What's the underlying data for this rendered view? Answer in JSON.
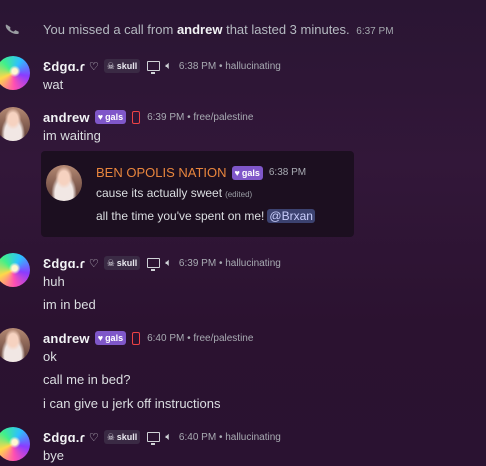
{
  "system": {
    "prefix": "You missed a call from",
    "caller": "andrew",
    "suffix": "that lasted 3 minutes.",
    "time": "6:37 PM"
  },
  "users": {
    "edgar": {
      "name": "Ɛdgɑ.ɾ",
      "heart": "♡",
      "tag": "skull"
    },
    "andrew": {
      "name": "andrew",
      "tag": "gals"
    }
  },
  "messages": [
    {
      "meta": "6:38 PM • hallucinating",
      "lines": [
        "wat"
      ]
    },
    {
      "meta": "6:39 PM • free/palestine",
      "lines": [
        "im waiting"
      ]
    },
    {
      "meta": "6:39 PM • hallucinating",
      "lines": [
        "huh",
        "im in bed"
      ]
    },
    {
      "meta": "6:40 PM • free/palestine",
      "lines": [
        "ok",
        "call me in bed?",
        "i can give u jerk off instructions"
      ]
    },
    {
      "meta": "6:40 PM • hallucinating",
      "lines": [
        "bye"
      ]
    }
  ],
  "embed": {
    "author": "BEN OPOLIS NATION",
    "tag": "gals",
    "time": "6:38 PM",
    "line1": "cause its actually sweet",
    "edited": "(edited)",
    "line2": "all the time you've spent on me!",
    "mention": "@Brxan"
  },
  "colors": {
    "embed_author": "#e8853d",
    "tag_gals": "#7f57c9",
    "mention_bg": "#3c4270",
    "phone_red": "#ed4245"
  }
}
